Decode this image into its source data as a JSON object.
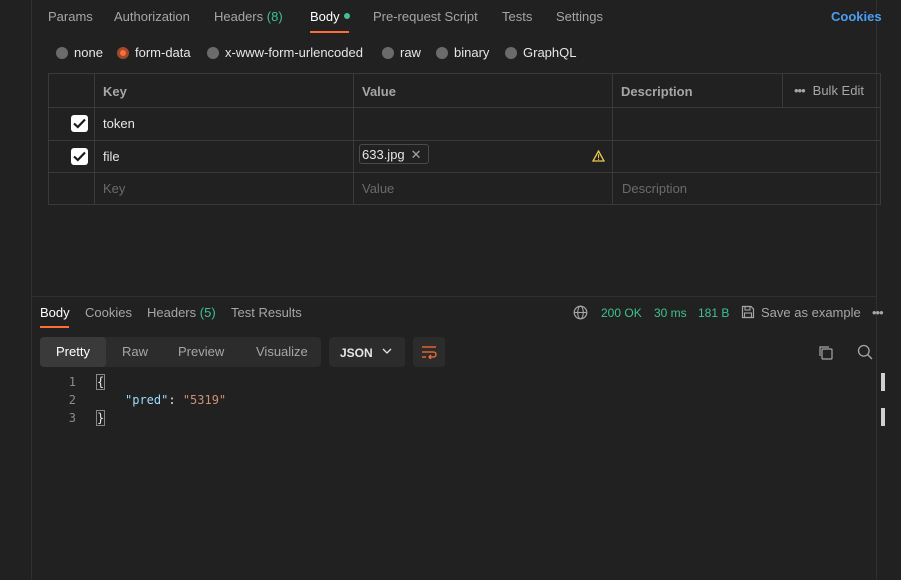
{
  "request_tabs": {
    "params": "Params",
    "authorization": "Authorization",
    "headers": "Headers",
    "headers_count": "(8)",
    "body": "Body",
    "prerequest": "Pre-request Script",
    "tests": "Tests",
    "settings": "Settings",
    "cookies": "Cookies"
  },
  "body_types": {
    "none": "none",
    "form_data": "form-data",
    "urlencoded": "x-www-form-urlencoded",
    "raw": "raw",
    "binary": "binary",
    "graphql": "GraphQL",
    "selected": "form-data"
  },
  "table": {
    "headers": {
      "key": "Key",
      "value": "Value",
      "description": "Description"
    },
    "bulk_edit": "Bulk Edit",
    "rows": [
      {
        "checked": true,
        "key": "token",
        "value": "",
        "description": ""
      },
      {
        "checked": true,
        "key": "file",
        "file": "633.jpg",
        "description": ""
      }
    ],
    "placeholders": {
      "key": "Key",
      "value": "Value",
      "description": "Description"
    }
  },
  "response_tabs": {
    "body": "Body",
    "cookies": "Cookies",
    "headers": "Headers",
    "headers_count": "(5)",
    "test_results": "Test Results"
  },
  "response_status": {
    "status": "200 OK",
    "time": "30 ms",
    "size": "181 B",
    "save_as_example": "Save as example"
  },
  "view_modes": {
    "pretty": "Pretty",
    "raw": "Raw",
    "preview": "Preview",
    "visualize": "Visualize",
    "format": "JSON"
  },
  "code": {
    "lines": [
      "1",
      "2",
      "3"
    ],
    "open_brace": "{",
    "key": "\"pred\"",
    "colon": ": ",
    "value": "\"5319\"",
    "close_brace": "}"
  },
  "colors": {
    "accent": "#ff6c37",
    "success": "#3ec28f",
    "link": "#4a9ff5",
    "background": "#212121"
  }
}
